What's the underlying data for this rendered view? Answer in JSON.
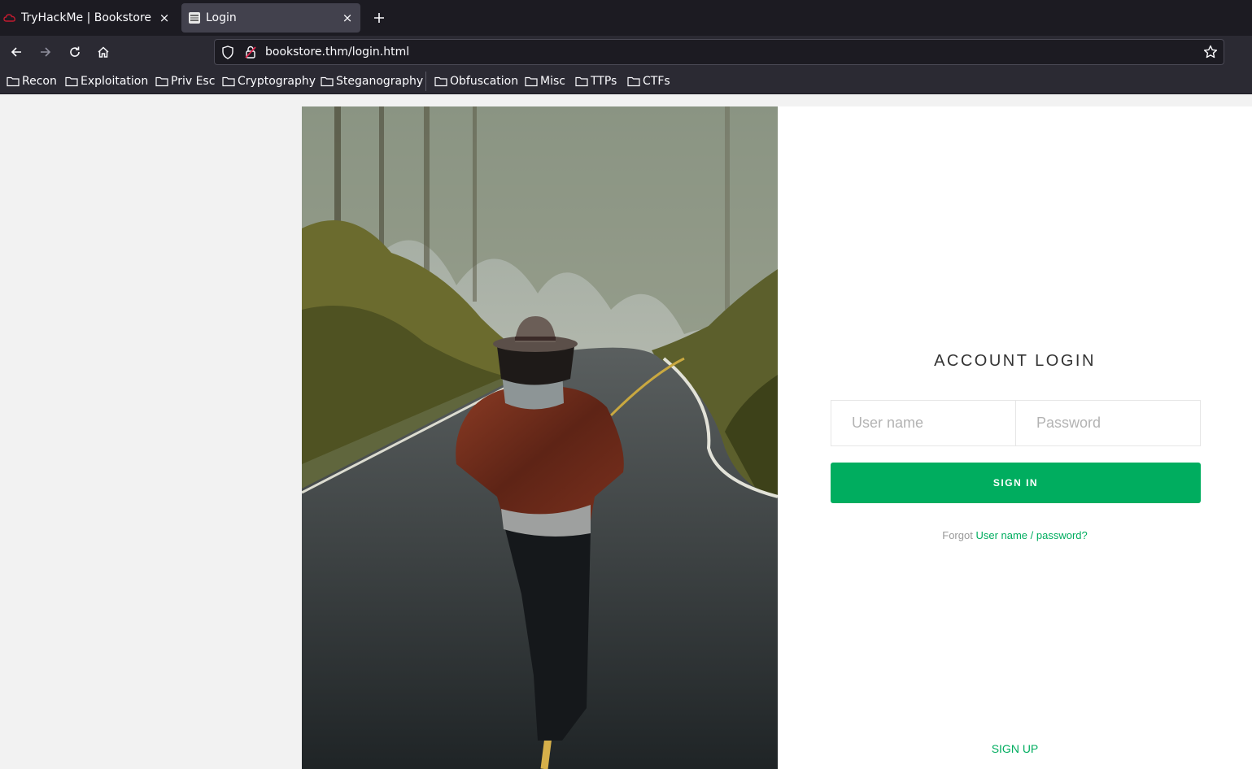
{
  "tabs": [
    {
      "title": "TryHackMe | Bookstore",
      "favicon": "tryhackme-cloud-icon",
      "active": false
    },
    {
      "title": "Login",
      "favicon": "book-stack-icon",
      "active": true
    }
  ],
  "tab_close_glyph": "×",
  "navbar": {
    "url": "bookstore.thm/login.html"
  },
  "bookmarks": [
    "Recon",
    "Exploitation",
    "Priv Esc",
    "Cryptography",
    "Steganography",
    "Obfuscation",
    "Misc",
    "TTPs",
    "CTFs"
  ],
  "login": {
    "title": "ACCOUNT LOGIN",
    "username_placeholder": "User name",
    "password_placeholder": "Password",
    "signin_label": "SIGN IN",
    "forgot_prefix": "Forgot",
    "forgot_link": "User name / password?",
    "signup_label": "SIGN UP",
    "accent_color": "#00ad5f"
  }
}
